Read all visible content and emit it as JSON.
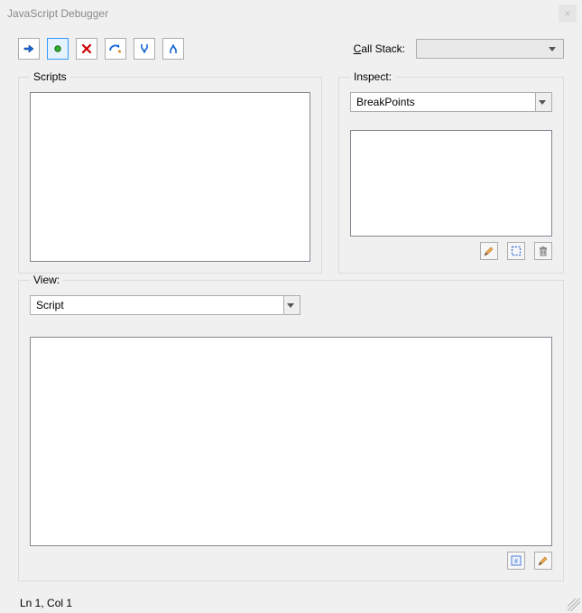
{
  "window": {
    "title": "JavaScript Debugger"
  },
  "toolbar": {
    "callstack_label_pre": "C",
    "callstack_label_post": "all Stack:",
    "callstack_value": ""
  },
  "scripts": {
    "legend": "Scripts"
  },
  "inspect": {
    "legend": "Inspect:",
    "selector_value": "BreakPoints"
  },
  "view": {
    "legend": "View:",
    "selector_value": "Script"
  },
  "status": {
    "position": "Ln 1, Col 1"
  }
}
